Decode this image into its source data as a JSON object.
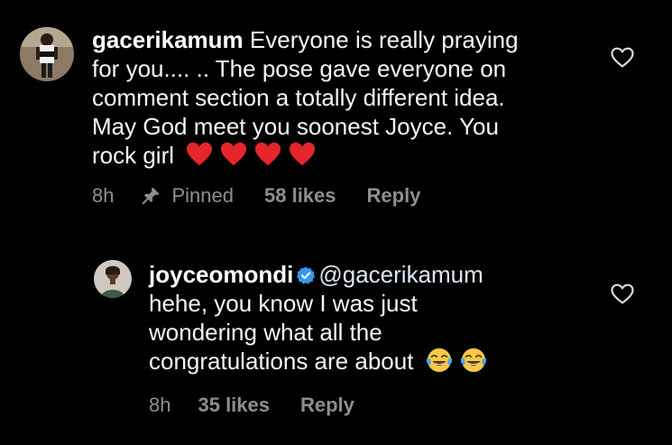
{
  "comments": [
    {
      "username": "gacerikamum",
      "text_lines": [
        "Everyone is really praying",
        "for you.... .. The pose gave everyone on",
        "comment section a  totally different idea.",
        "May God meet you soonest Joyce. You",
        "rock girl"
      ],
      "emoji": [
        "red-heart",
        "red-heart",
        "red-heart",
        "red-heart"
      ],
      "time": "8h",
      "pinned_label": "Pinned",
      "likes": "58 likes",
      "reply_label": "Reply",
      "liked": false
    },
    {
      "username": "joyceomondi",
      "verified": true,
      "mention": "@gacerikamum",
      "text_lines": [
        "hehe, you know I was just",
        "wondering what all the",
        "congratulations are about"
      ],
      "emoji": [
        "face-with-tears-of-joy",
        "face-with-tears-of-joy"
      ],
      "time": "8h",
      "likes": "35 likes",
      "reply_label": "Reply",
      "liked": false
    }
  ],
  "colors": {
    "background": "#000000",
    "text": "#f5f5f5",
    "meta": "#8e8e8e",
    "verified": "#3897f0",
    "heart": "#e5262b"
  }
}
